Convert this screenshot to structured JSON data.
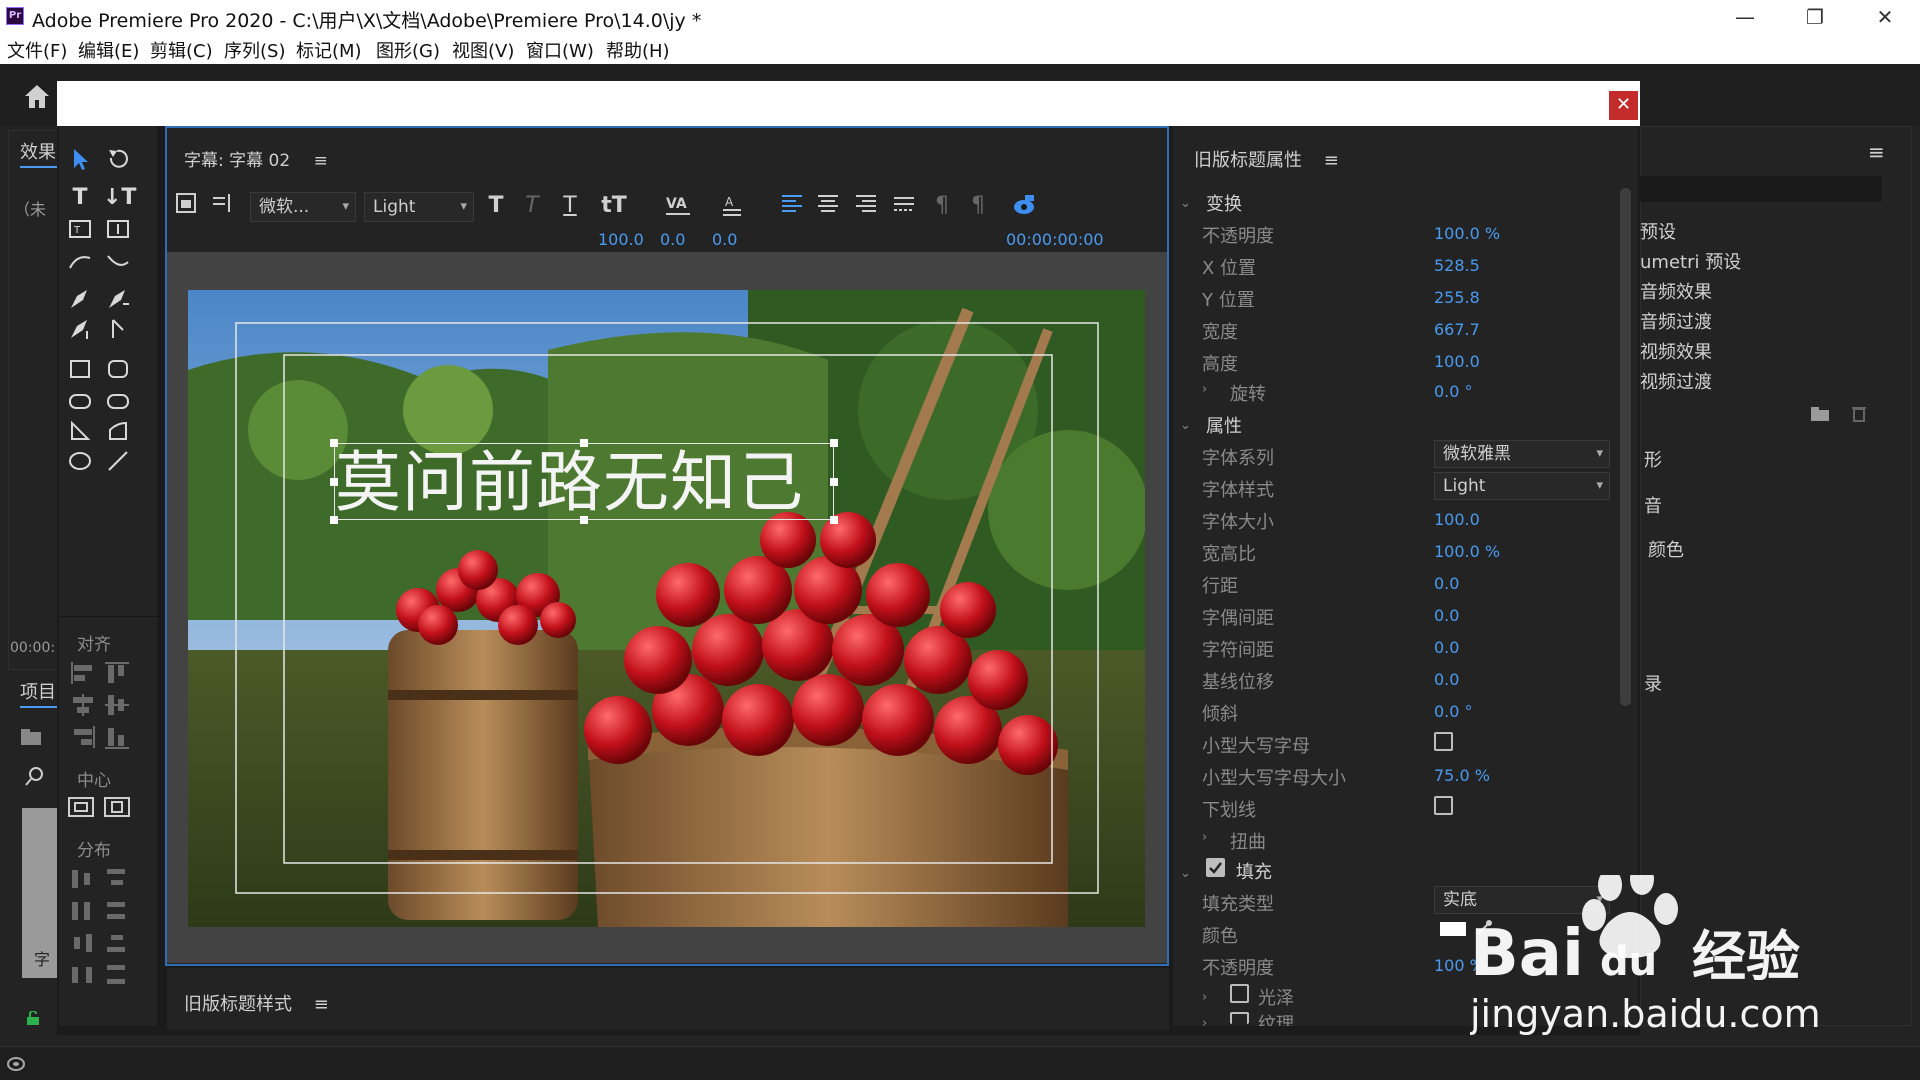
{
  "window": {
    "title": "Adobe Premiere Pro 2020 - C:\\用户\\X\\文档\\Adobe\\Premiere Pro\\14.0\\jy *",
    "app_icon": "Pr",
    "minimize": "—",
    "restore": "❐",
    "close": "✕"
  },
  "menu": [
    "文件(F)",
    "编辑(E)",
    "剪辑(C)",
    "序列(S)",
    "标记(M)",
    "图形(G)",
    "视图(V)",
    "窗口(W)",
    "帮助(H)"
  ],
  "background_panels": {
    "effects_tab": "效果",
    "search_hint": "（未",
    "timecode": "00:00:",
    "project_tab": "项目",
    "caption_label": "字",
    "right_list": [
      "预设",
      "umetri 预设",
      "音频效果",
      "音频过渡",
      "视频效果",
      "视频过渡"
    ],
    "right_sections": [
      "形",
      "音",
      "颜色",
      "录"
    ]
  },
  "tools": {
    "align_label": "对齐",
    "center_label": "中心",
    "distribute_label": "分布"
  },
  "titler": {
    "tab_label": "字幕: 字幕 02",
    "font_family": "微软...",
    "font_style": "Light",
    "font_size": "100.0",
    "kerning": "0.0",
    "leading": "0.0",
    "timecode": "00:00:00:00",
    "caption_text": "莫问前路无知己",
    "styles_label": "旧版标题样式"
  },
  "properties": {
    "title": "旧版标题属性",
    "transform_section": "变换",
    "transform": [
      {
        "label": "不透明度",
        "value": "100.0 %"
      },
      {
        "label": "X 位置",
        "value": "528.5"
      },
      {
        "label": "Y 位置",
        "value": "255.8"
      },
      {
        "label": "宽度",
        "value": "667.7"
      },
      {
        "label": "高度",
        "value": "100.0"
      },
      {
        "label": "旋转",
        "value": "0.0 °"
      }
    ],
    "attributes_section": "属性",
    "font_family_label": "字体系列",
    "font_family_value": "微软雅黑",
    "font_style_label": "字体样式",
    "font_style_value": "Light",
    "attributes": [
      {
        "label": "字体大小",
        "value": "100.0"
      },
      {
        "label": "宽高比",
        "value": "100.0 %"
      },
      {
        "label": "行距",
        "value": "0.0"
      },
      {
        "label": "字偶间距",
        "value": "0.0"
      },
      {
        "label": "字符间距",
        "value": "0.0"
      },
      {
        "label": "基线位移",
        "value": "0.0"
      },
      {
        "label": "倾斜",
        "value": "0.0 °"
      }
    ],
    "small_caps_label": "小型大写字母",
    "small_caps_size_label": "小型大写字母大小",
    "small_caps_size_value": "75.0 %",
    "underline_label": "下划线",
    "distort_label": "扭曲",
    "fill_section": "填充",
    "fill_type_label": "填充类型",
    "fill_type_value": "实底",
    "color_label": "颜色",
    "fill_opacity_label": "不透明度",
    "fill_opacity_value": "100 %",
    "sheen_label": "光泽",
    "texture_label": "纹理"
  },
  "watermark": {
    "brand": "Bai",
    "brand2": "du",
    "cn": "经验",
    "url": "jingyan.baidu.com"
  },
  "colors": {
    "accent_blue": "#4a9bf0",
    "panel_border": "#2f6db4",
    "close_red": "#c42b2b"
  }
}
